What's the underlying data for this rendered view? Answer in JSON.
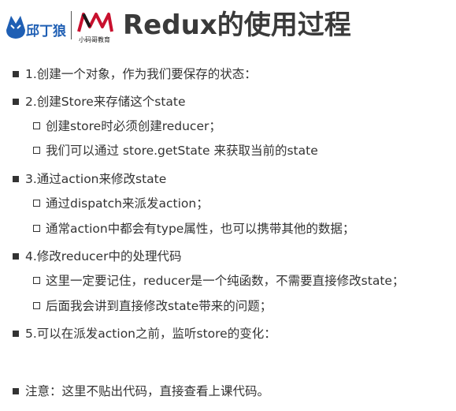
{
  "header": {
    "title": "Redux的使用过程",
    "logo_brand": "邱丁狼",
    "logo_sub": "小码哥教育",
    "logo_mark": "M"
  },
  "items": [
    {
      "level": 1,
      "text": "1.创建一个对象，作为我们要保存的状态："
    },
    {
      "level": 1,
      "text": "2.创建Store来存储这个state"
    },
    {
      "level": 2,
      "text": "创建store时必须创建reducer；"
    },
    {
      "level": 2,
      "text": "我们可以通过 store.getState 来获取当前的state"
    },
    {
      "level": 1,
      "text": "3.通过action来修改state"
    },
    {
      "level": 2,
      "text": "通过dispatch来派发action；"
    },
    {
      "level": 2,
      "text": "通常action中都会有type属性，也可以携带其他的数据；"
    },
    {
      "level": 1,
      "text": "4.修改reducer中的处理代码"
    },
    {
      "level": 2,
      "text": "这里一定要记住，reducer是一个纯函数，不需要直接修改state；"
    },
    {
      "level": 2,
      "text": "后面我会讲到直接修改state带来的问题；"
    },
    {
      "level": 1,
      "text": "5.可以在派发action之前，监听store的变化："
    },
    {
      "level": 1,
      "text": "注意：这里不贴出代码，直接查看上课代码。"
    }
  ]
}
